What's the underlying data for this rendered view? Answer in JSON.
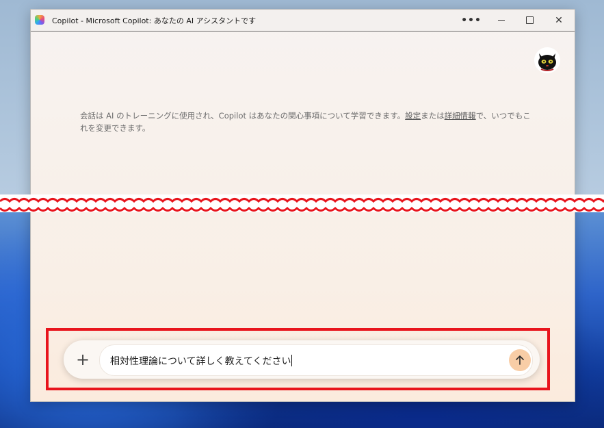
{
  "window": {
    "title": "Copilot - Microsoft Copilot: あなたの AI アシスタントです",
    "more_label": "•••",
    "close_label": "✕"
  },
  "notice": {
    "text_before": "会話は AI のトレーニングに使用され、Copilot はあなたの関心事項について学習できます。",
    "link_settings": "設定",
    "text_mid": "または",
    "link_details": "詳細情報",
    "text_after": "で、いつでもこれを変更できます。"
  },
  "composer": {
    "plus_label": "+",
    "input_value": "相対性理論について詳しく教えてください",
    "send_icon": "arrow-up-icon"
  },
  "colors": {
    "annotation_red": "#e8141c",
    "send_button": "#f8cda6"
  }
}
